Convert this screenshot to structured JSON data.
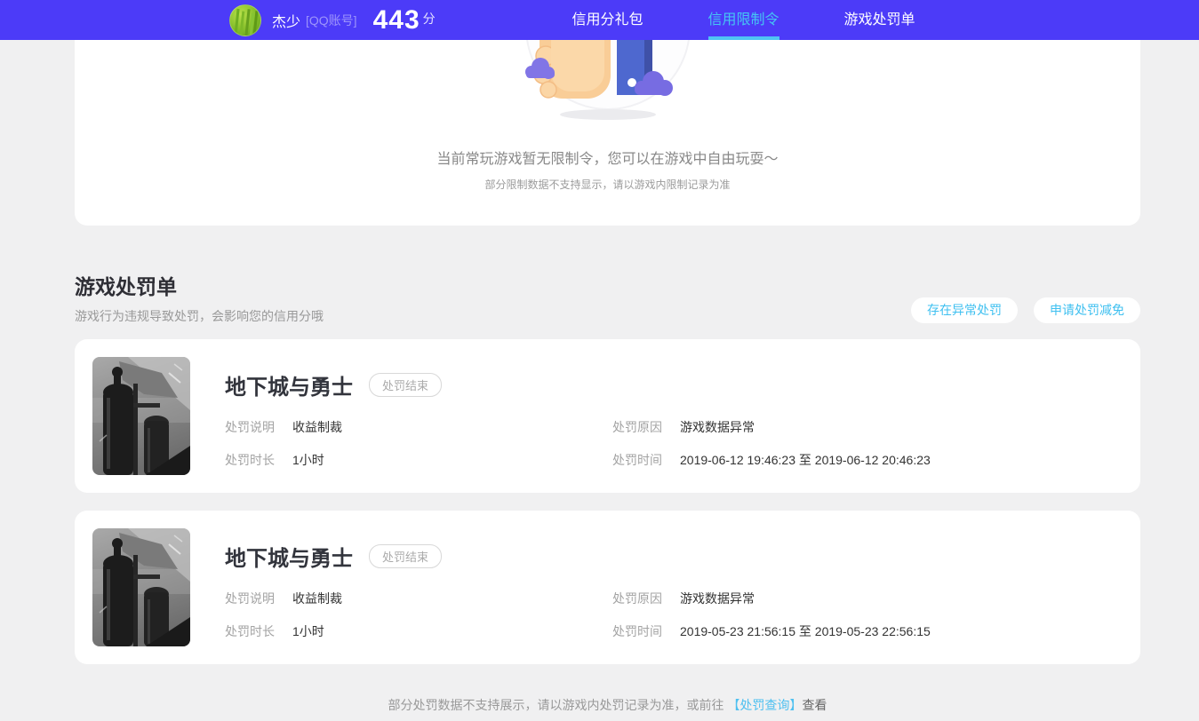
{
  "header": {
    "username": "杰少",
    "account_tag": "[QQ账号]",
    "score": "443",
    "score_unit": "分",
    "nav": [
      {
        "label": "信用分礼包"
      },
      {
        "label": "信用限制令"
      },
      {
        "label": "游戏处罚单"
      }
    ]
  },
  "restriction_card": {
    "message": "当前常玩游戏暂无限制令，您可以在游戏中自由玩耍～",
    "note": "部分限制数据不支持显示，请以游戏内限制记录为准"
  },
  "penalty_section": {
    "title": "游戏处罚单",
    "subtitle": "游戏行为违规导致处罚，会影响您的信用分哦",
    "actions": [
      {
        "label": "存在异常处罚"
      },
      {
        "label": "申请处罚减免"
      }
    ],
    "cards": [
      {
        "game": "地下城与勇士",
        "status": "处罚结束",
        "desc_label": "处罚说明",
        "desc": "收益制裁",
        "reason_label": "处罚原因",
        "reason": "游戏数据异常",
        "duration_label": "处罚时长",
        "duration": "1小时",
        "time_label": "处罚时间",
        "time": "2019-06-12 19:46:23 至 2019-06-12 20:46:23"
      },
      {
        "game": "地下城与勇士",
        "status": "处罚结束",
        "desc_label": "处罚说明",
        "desc": "收益制裁",
        "reason_label": "处罚原因",
        "reason": "游戏数据异常",
        "duration_label": "处罚时长",
        "duration": "1小时",
        "time_label": "处罚时间",
        "time": "2019-05-23 21:56:15 至 2019-05-23 22:56:15"
      }
    ]
  },
  "footer": {
    "text": "部分处罚数据不支持展示，请以游戏内处罚记录为准，或前往 ",
    "link": "【处罚查询】",
    "suffix": "查看"
  },
  "colors": {
    "header_bg": "#4c3bf8",
    "accent_cyan": "#45c6f3",
    "page_bg": "#f0f0f1"
  }
}
